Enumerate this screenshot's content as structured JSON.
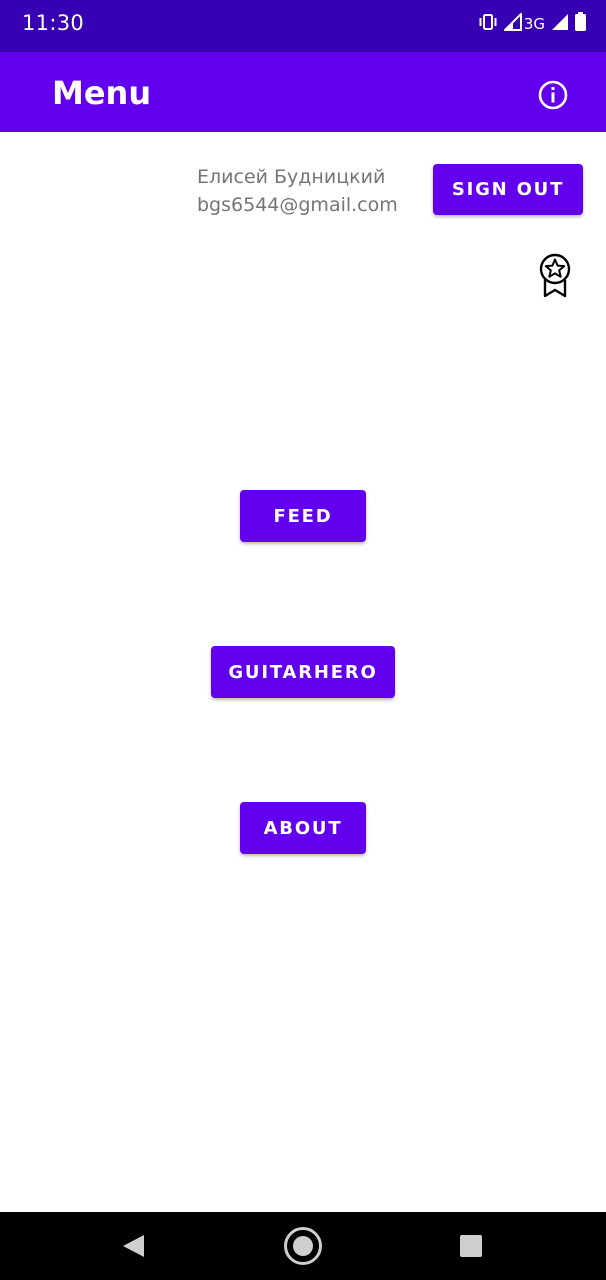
{
  "status_bar": {
    "time": "11:30",
    "network_label": "3G",
    "icons": [
      "vibrate-icon",
      "signal-icon",
      "signal-icon",
      "battery-icon"
    ]
  },
  "app_bar": {
    "title": "Menu",
    "info_icon": "info-icon"
  },
  "user": {
    "name": "Елисей Будницкий",
    "email": "bgs6544@gmail.com"
  },
  "buttons": {
    "sign_out": "SIGN OUT",
    "feed": "FEED",
    "guitarhero": "GUITARHERO",
    "about": "ABOUT"
  },
  "award_icon": "award-icon",
  "nav": {
    "icons": [
      "back-icon",
      "home-icon",
      "recents-icon"
    ]
  },
  "colors": {
    "status_bar": "#3700b3",
    "primary": "#6200ee",
    "on_primary": "#ffffff",
    "secondary_text": "#757575",
    "nav_bar": "#000000"
  }
}
